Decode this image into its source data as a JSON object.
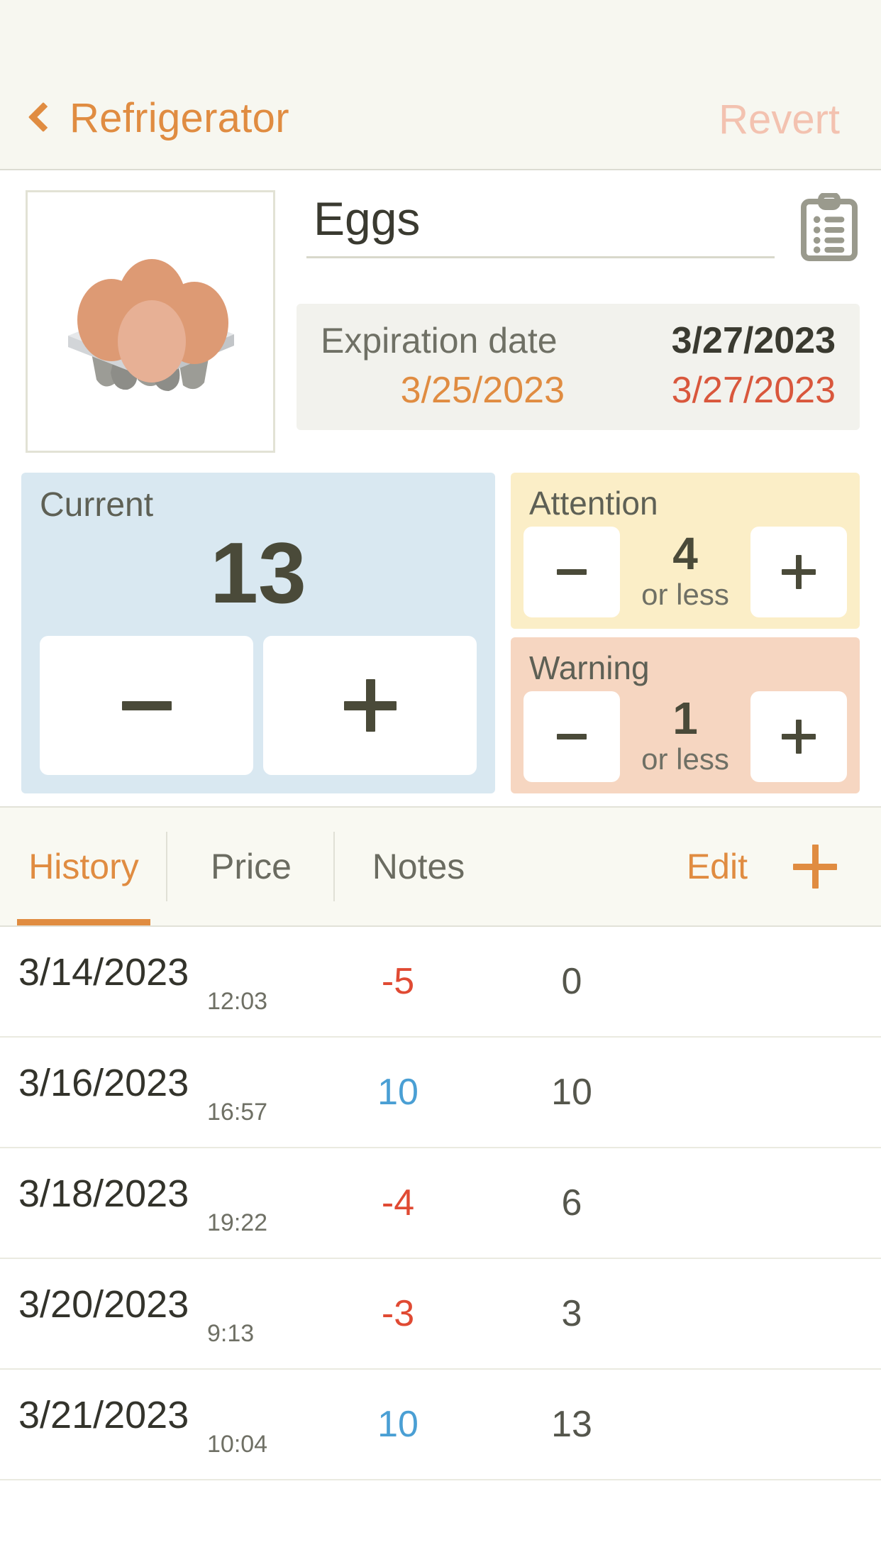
{
  "navbar": {
    "back_icon": "chevron-left-icon",
    "title": "Refrigerator",
    "revert_label": "Revert",
    "accent_color": "#e08c41",
    "revert_color": "#f3c2b0"
  },
  "item": {
    "name": "Eggs",
    "thumbnail_icon": "egg-carton-image",
    "clipboard_icon": "clipboard-list-icon"
  },
  "expiration": {
    "label": "Expiration date",
    "main_date": "3/27/2023",
    "left_date": "3/25/2023",
    "right_date": "3/27/2023",
    "left_date_color": "#e08c41",
    "right_date_color": "#d9573c"
  },
  "current": {
    "label": "Current",
    "value": "13",
    "decrement_icon": "minus-icon",
    "increment_icon": "plus-icon",
    "bg_color": "#d9e8f1"
  },
  "thresholds": [
    {
      "label": "Attention",
      "value": "4",
      "suffix": "or less",
      "decrement_icon": "minus-icon",
      "increment_icon": "plus-icon",
      "bg_color": "#fbeec7"
    },
    {
      "label": "Warning",
      "value": "1",
      "suffix": "or less",
      "decrement_icon": "minus-icon",
      "increment_icon": "plus-icon",
      "bg_color": "#f6d6c1"
    }
  ],
  "tabs": [
    {
      "label": "History",
      "active": true
    },
    {
      "label": "Price",
      "active": false
    },
    {
      "label": "Notes",
      "active": false
    }
  ],
  "actions": {
    "edit_label": "Edit",
    "add_icon": "plus-icon"
  },
  "history": [
    {
      "date": "3/14/2023",
      "time": "12:03",
      "delta": "-5",
      "sign": "neg",
      "total": "0"
    },
    {
      "date": "3/16/2023",
      "time": "16:57",
      "delta": "10",
      "sign": "pos",
      "total": "10"
    },
    {
      "date": "3/18/2023",
      "time": "19:22",
      "delta": "-4",
      "sign": "neg",
      "total": "6"
    },
    {
      "date": "3/20/2023",
      "time": "9:13",
      "delta": "-3",
      "sign": "neg",
      "total": "3"
    },
    {
      "date": "3/21/2023",
      "time": "10:04",
      "delta": "10",
      "sign": "pos",
      "total": "13"
    }
  ]
}
